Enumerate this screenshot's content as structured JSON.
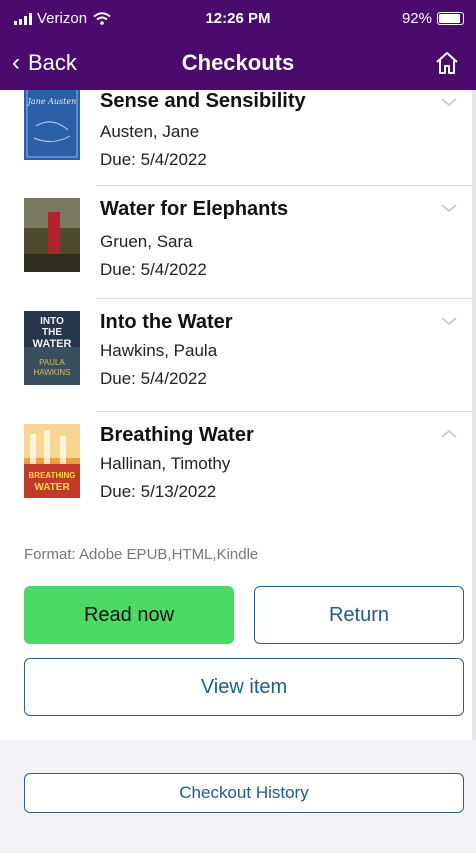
{
  "status_bar": {
    "carrier": "Verizon",
    "time": "12:26 PM",
    "battery": "92%",
    "battery_level": 0.92
  },
  "nav": {
    "back_label": "Back",
    "title": "Checkouts"
  },
  "checkouts": [
    {
      "title": "Sense and Sensibility",
      "author": "Austen, Jane",
      "due": "Due: 5/4/2022",
      "expanded": false
    },
    {
      "title": "Water for Elephants",
      "author": "Gruen, Sara",
      "due": "Due: 5/4/2022",
      "expanded": false
    },
    {
      "title": "Into the Water",
      "author": "Hawkins, Paula",
      "due": "Due: 5/4/2022",
      "expanded": false
    },
    {
      "title": "Breathing Water",
      "author": "Hallinan, Timothy",
      "due": "Due: 5/13/2022",
      "expanded": true
    }
  ],
  "covers": {
    "sense": {
      "text": "Jane Austen",
      "color": "#2a5fa8"
    },
    "into": {
      "lines": [
        "INTO",
        "THE",
        "WATER",
        "PAULA",
        "HAWKINS"
      ]
    },
    "breathing": {
      "lines": [
        "BREATHING",
        "WATER"
      ]
    }
  },
  "detail": {
    "format": "Format: Adobe EPUB,HTML,Kindle",
    "read_now": "Read now",
    "return": "Return",
    "view_item": "View item"
  },
  "footer": {
    "checkout_history": "Checkout History"
  },
  "colors": {
    "header": "#4b0b6e",
    "read_button": "#4cd964",
    "outline_button": "#1f5c8a"
  }
}
